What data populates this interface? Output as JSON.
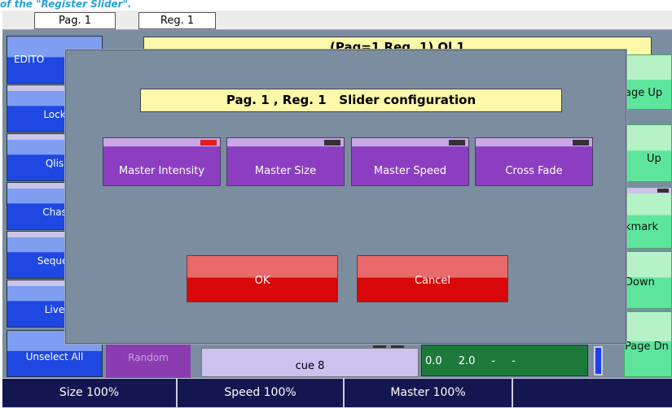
{
  "caption": "of the \"Register Slider\".",
  "tabs": {
    "page": "Pag. 1",
    "register": "Reg. 1"
  },
  "header": {
    "title": "(Pag=1 Reg. 1) Ql 1"
  },
  "left_buttons": [
    "EDITO",
    "Lock",
    "Qlis",
    "Chas",
    "Sequer",
    "Live",
    "Unselect All"
  ],
  "right_buttons": [
    "age Up",
    "Up",
    "kmark",
    "Down",
    "Page Dn"
  ],
  "random_label": "Random",
  "cue_label": "cue 8",
  "readout": [
    "0.0",
    "2.0",
    "-",
    "-"
  ],
  "footer": {
    "size": "Size 100%",
    "speed": "Speed 100%",
    "master": "Master 100%"
  },
  "dialog": {
    "title": "Pag. 1 , Reg. 1   Slider configuration",
    "options": [
      {
        "label": "Master Intensity",
        "selected": true
      },
      {
        "label": "Master Size",
        "selected": false
      },
      {
        "label": "Master Speed",
        "selected": false
      },
      {
        "label": "Cross Fade",
        "selected": false
      }
    ],
    "ok": "OK",
    "cancel": "Cancel"
  },
  "colors": {
    "indicator_on": "#e02020",
    "indicator_off": "#333333",
    "dialog_background": "#7c8da0",
    "title_background": "#fbf8a9",
    "button_red": "#d90707",
    "option_purple": "#8b3fc0"
  }
}
